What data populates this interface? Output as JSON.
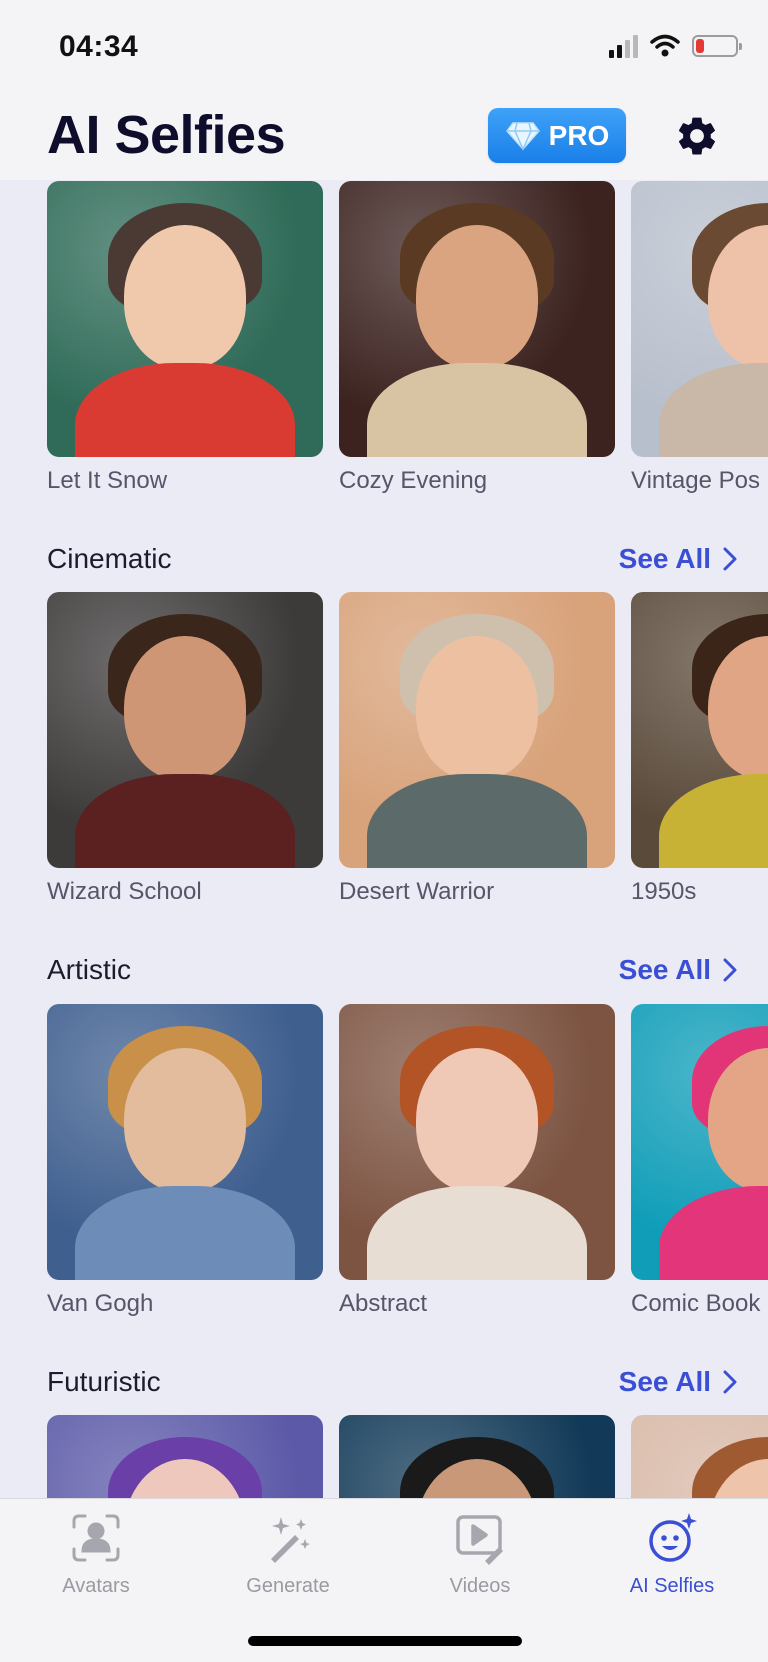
{
  "status": {
    "time": "04:34"
  },
  "header": {
    "title": "AI Selfies",
    "pro_label": "PRO"
  },
  "top_row": [
    {
      "label": "Let It Snow",
      "bg": "#2f6b58",
      "skin": "#f0c9ad",
      "hair": "#4b3a33",
      "outfit": "#d93a32"
    },
    {
      "label": "Cozy Evening",
      "bg": "#3c2320",
      "skin": "#d9a47f",
      "hair": "#5a3a22",
      "outfit": "#d8c3a2"
    },
    {
      "label": "Vintage Pos",
      "bg": "#b8bfcc",
      "skin": "#eec2a8",
      "hair": "#6b4a33",
      "outfit": "#c9b7a7"
    }
  ],
  "sections": [
    {
      "title": "Cinematic",
      "see_all": "See All",
      "items": [
        {
          "label": "Wizard School",
          "bg": "#3d3a3a",
          "skin": "#cf9676",
          "hair": "#3b261b",
          "outfit": "#5b2020"
        },
        {
          "label": "Desert Warrior",
          "bg": "#d8a27a",
          "skin": "#eec0a2",
          "hair": "#cfc0ad",
          "outfit": "#5c6a6a"
        },
        {
          "label": "1950s",
          "bg": "#5a4a3a",
          "skin": "#e0a585",
          "hair": "#3a2518",
          "outfit": "#c8b236"
        }
      ]
    },
    {
      "title": "Artistic",
      "see_all": "See All",
      "items": [
        {
          "label": "Van Gogh",
          "bg": "#3f5f8f",
          "skin": "#e3bc9e",
          "hair": "#c89048",
          "outfit": "#6d8cb8"
        },
        {
          "label": "Abstract",
          "bg": "#7d5442",
          "skin": "#efc8b6",
          "hair": "#b25426",
          "outfit": "#e7ddd2"
        },
        {
          "label": "Comic Book",
          "bg": "#0f9db8",
          "skin": "#e4a486",
          "hair": "#e23578",
          "outfit": "#e2357a"
        }
      ]
    },
    {
      "title": "Futuristic",
      "see_all": "See All",
      "items": [
        {
          "label": "",
          "bg": "#5c5aa8",
          "skin": "#eec8bc",
          "hair": "#6b3fa8",
          "outfit": "#6c6cbb"
        },
        {
          "label": "",
          "bg": "#123a58",
          "skin": "#c99878",
          "hair": "#1a1a1a",
          "outfit": "#1c2d44"
        },
        {
          "label": "",
          "bg": "#d8b8a6",
          "skin": "#eec4aa",
          "hair": "#a05a32",
          "outfit": "#d8c0b0"
        }
      ]
    }
  ],
  "tabs": [
    {
      "label": "Avatars",
      "icon": "avatar-scan-icon",
      "active": false
    },
    {
      "label": "Generate",
      "icon": "magic-wand-icon",
      "active": false
    },
    {
      "label": "Videos",
      "icon": "video-edit-icon",
      "active": false
    },
    {
      "label": "AI Selfies",
      "icon": "sparkle-face-icon",
      "active": true
    }
  ],
  "colors": {
    "accent": "#3a4fd4",
    "pro_gradient_top": "#3ea2f8",
    "pro_gradient_bottom": "#1a7fe8"
  }
}
